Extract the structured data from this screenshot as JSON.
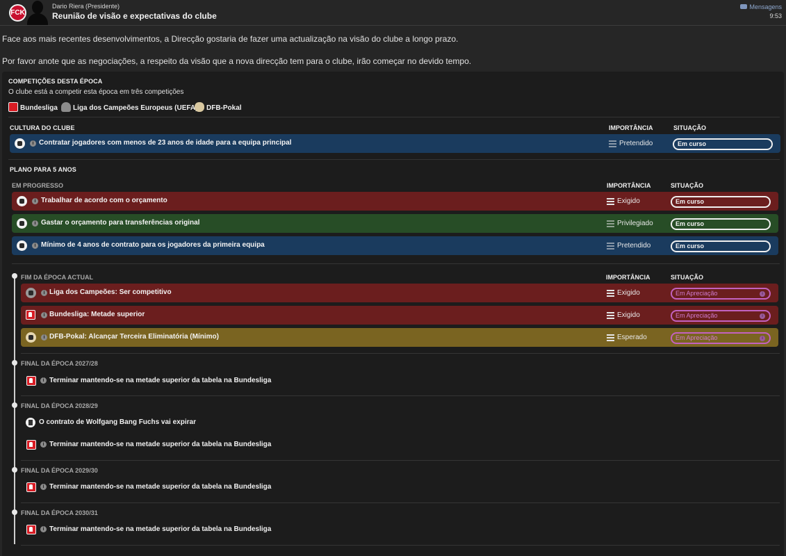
{
  "header": {
    "club_logo_text": "FCK",
    "sender_name": "Dario Riera",
    "sender_role": "(Presidente)",
    "subject": "Reunião de visão e expectativas do clube",
    "messages_label": "Mensagens",
    "time": "9:53"
  },
  "intro": {
    "paragraph1": "Face aos mais recentes desenvolvimentos, a Direcção gostaria de fazer uma actualização na visão do clube a longo prazo.",
    "paragraph2": "Por favor anote que as negociações, a respeito da visão que a nova direcção tem para o clube, irão começar no devido tempo."
  },
  "competitions": {
    "title": "COMPETIÇÕES DESTA ÉPOCA",
    "subtitle": "O clube está a competir esta época em três competições",
    "items": [
      {
        "name": "Bundesliga",
        "icon": "bundesliga-icon"
      },
      {
        "name": "Liga dos Campeões Europeus (UEFA)",
        "icon": "champions-league-icon"
      },
      {
        "name": "DFB-Pokal",
        "icon": "dfb-pokal-icon"
      }
    ]
  },
  "columns": {
    "importance": "IMPORTÂNCIA",
    "situation": "SITUAÇÃO"
  },
  "culture": {
    "title": "CULTURA DO CLUBE",
    "rows": [
      {
        "text": "Contratar jogadores com menos de 23 anos de idade para a equipa principal",
        "importance": "Pretendido",
        "status": "Em curso",
        "color": "#1a3b5e"
      }
    ]
  },
  "plan": {
    "title": "PLANO PARA 5 ANOS",
    "in_progress_title": "EM PROGRESSO",
    "in_progress": [
      {
        "text": "Trabalhar de acordo com o orçamento",
        "importance": "Exigido",
        "status": "Em curso",
        "color": "#6b1e1e"
      },
      {
        "text": "Gastar o orçamento para transferências original",
        "importance": "Privilegiado",
        "status": "Em curso",
        "color": "#274d26"
      },
      {
        "text": "Mínimo de 4 anos de contrato para os jogadores da primeira equipa",
        "importance": "Pretendido",
        "status": "Em curso",
        "color": "#1a3b5e"
      }
    ],
    "current_season_title": "FIM DA ÉPOCA ACTUAL",
    "current_season": [
      {
        "text": "Liga dos Campeões: Ser competitivo",
        "importance": "Exigido",
        "status": "Em Apreciação",
        "color": "#6b1e1e"
      },
      {
        "text": "Bundesliga: Metade superior",
        "importance": "Exigido",
        "status": "Em Apreciação",
        "color": "#6b1e1e"
      },
      {
        "text": "DFB-Pokal: Alcançar Terceira Eliminatória (Mínimo)",
        "importance": "Esperado",
        "status": "Em Apreciação",
        "color": "#7a6421"
      }
    ],
    "future": [
      {
        "title": "FINAL DA ÉPOCA 2027/28",
        "items": [
          "Terminar mantendo-se na metade superior da tabela na Bundesliga"
        ]
      },
      {
        "title": "FINAL DA ÉPOCA 2028/29",
        "contract": "O contrato de Wolfgang Bang Fuchs vai expirar",
        "items": [
          "Terminar mantendo-se na metade superior da tabela na Bundesliga"
        ]
      },
      {
        "title": "FINAL DA ÉPOCA 2029/30",
        "items": [
          "Terminar mantendo-se na metade superior da tabela na Bundesliga"
        ]
      },
      {
        "title": "FINAL DA ÉPOCA 2030/31",
        "items": [
          "Terminar mantendo-se na metade superior da tabela na Bundesliga"
        ]
      }
    ]
  }
}
